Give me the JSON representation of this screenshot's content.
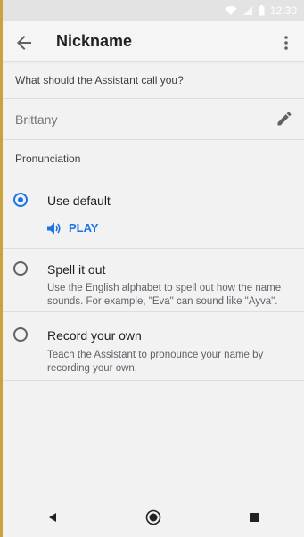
{
  "status_bar": {
    "time": "12:30",
    "icons": [
      "wifi-icon",
      "signal-icon",
      "battery-icon"
    ]
  },
  "toolbar": {
    "title": "Nickname",
    "back_icon": "arrow-back-icon",
    "menu_icon": "more-vert-icon"
  },
  "question": {
    "label": "What should the Assistant call you?"
  },
  "nickname_field": {
    "value": "Brittany",
    "edit_icon": "pencil-icon"
  },
  "pronunciation": {
    "label": "Pronunciation",
    "options": [
      {
        "title": "Use default",
        "selected": true,
        "play_label": "PLAY"
      },
      {
        "title": "Spell it out",
        "selected": false,
        "description": "Use the English alphabet to spell out how the name sounds. For example, \"Eva\" can sound like \"Ayva\"."
      },
      {
        "title": "Record your own",
        "selected": false,
        "description": "Teach the Assistant to pronounce your name by recording your own."
      }
    ]
  },
  "nav_bar": {
    "icons": [
      "back-triangle-icon",
      "home-circle-icon",
      "recents-square-icon"
    ]
  },
  "colors": {
    "accent": "#1a73e8",
    "background": "#f2f2f2",
    "divider": "#dedede"
  }
}
